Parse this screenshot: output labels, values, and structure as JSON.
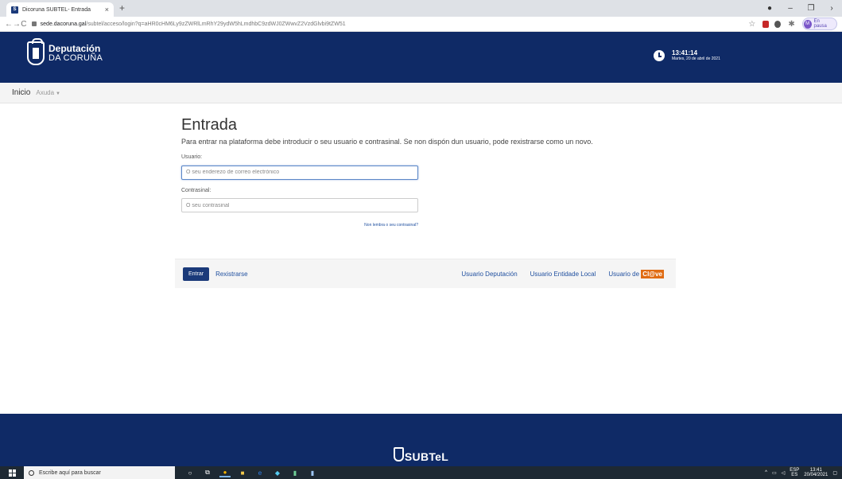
{
  "browser": {
    "tab_title": "Dicoruna SUBTEL- Entrada",
    "tab_favicon": "S",
    "url_host": "sede.dacoruna.gal",
    "url_path": "/subtel/acceso/login?q=aHR0cHM6Ly9zZWRlLmRhY29ydW5hLmdhbC9zdWJ0ZWwvZ2VzdGlvbi9tZW51",
    "profile_initial": "M",
    "profile_label": "En pausa"
  },
  "header": {
    "logo_line1": "Deputación",
    "logo_line2": "DA CORUÑA",
    "time": "13:41:14",
    "date": "Martes, 20 de abril de 2021"
  },
  "nav": {
    "home": "Inicio",
    "help": "Axuda"
  },
  "login": {
    "title": "Entrada",
    "intro": "Para entrar na plataforma debe introducir o seu usuario e contrasinal. Se non dispón dun usuario, pode rexistrarse como un novo.",
    "user_label": "Usuario:",
    "user_placeholder": "O seu enderezo de correo electrónico",
    "pass_label": "Contrasinal:",
    "pass_placeholder": "O seu contrasinal",
    "forgot": "Non lembra o seu contrasinal?"
  },
  "actions": {
    "enter": "Entrar",
    "register": "Rexistrarse",
    "user_deputacion": "Usuario Deputación",
    "user_entidade": "Usuario Entidade Local",
    "user_clave_prefix": "Usuario de",
    "clave_badge": "Cl@ve"
  },
  "footer": {
    "logo_text": "SUBTeL"
  },
  "taskbar": {
    "search_placeholder": "Escribe aquí para buscar",
    "lang": "ESP",
    "lang_sub": "ES",
    "time": "13:41",
    "date": "20/04/2021"
  },
  "colors": {
    "brand_navy": "#0f2a66",
    "button_navy": "#1b3a7a",
    "clave_orange": "#e06c13"
  }
}
